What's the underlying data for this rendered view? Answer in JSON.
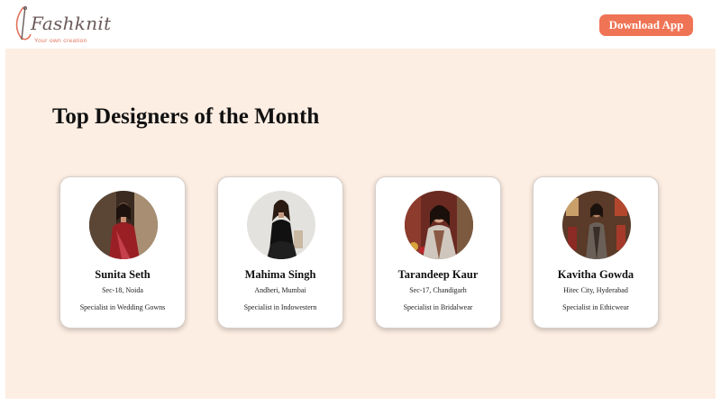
{
  "header": {
    "logo_text": "Fashknit",
    "logo_tagline": "Your own creation",
    "download_label": "Download App"
  },
  "section": {
    "title": "Top Designers of the Month"
  },
  "designers": [
    {
      "name": "Sunita Seth",
      "location": "Sec-18, Noida",
      "specialty": "Specialist in Wedding Gowns"
    },
    {
      "name": "Mahima Singh",
      "location": "Andheri, Mumbai",
      "specialty": "Specialist in Indowestern"
    },
    {
      "name": "Tarandeep Kaur",
      "location": "Sec-17, Chandigarh",
      "specialty": "Specialist in Bridalwear"
    },
    {
      "name": "Kavitha Gowda",
      "location": "Hitec City, Hyderabad",
      "specialty": "Specialist in Ethicwear"
    }
  ],
  "colors": {
    "accent": "#ef7455",
    "panel_bg": "#fdeee3",
    "card_bg": "#ffffff"
  }
}
